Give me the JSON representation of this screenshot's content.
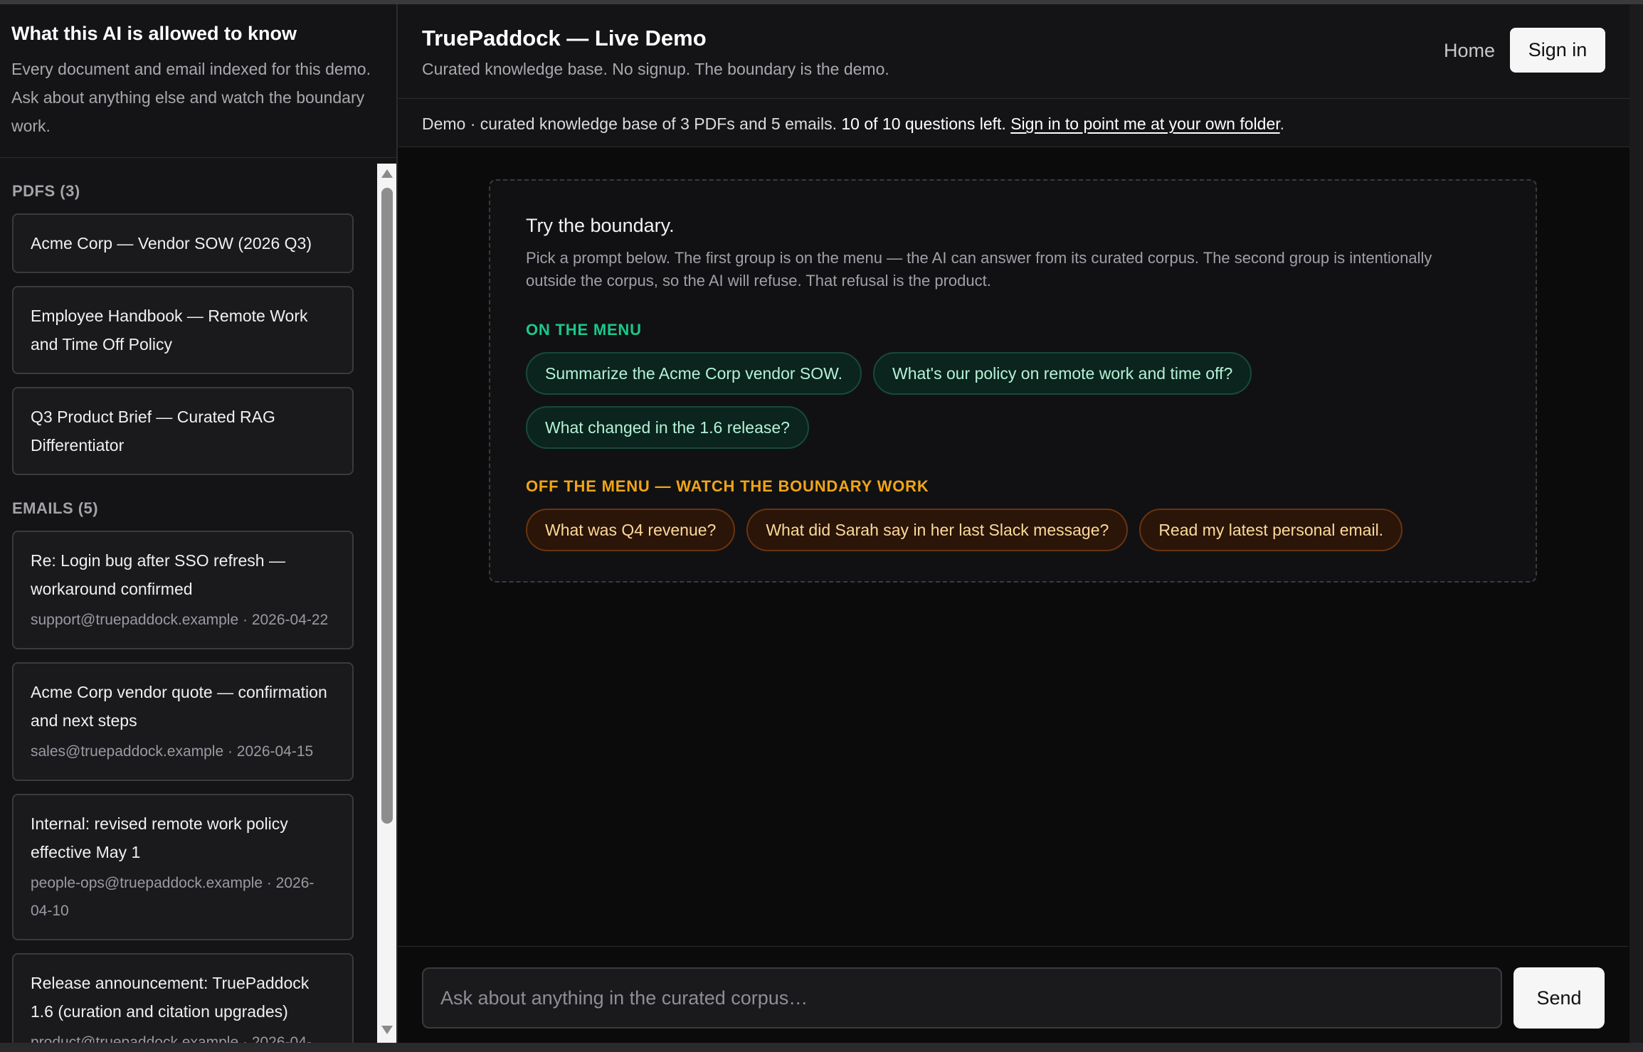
{
  "sidebar": {
    "title": "What this AI is allowed to know",
    "description": "Every document and email indexed for this demo. Ask about anything else and watch the boundary work.",
    "pdfs_label": "PDFS (3)",
    "pdfs": [
      {
        "title": "Acme Corp — Vendor SOW (2026 Q3)"
      },
      {
        "title": "Employee Handbook — Remote Work and Time Off Policy"
      },
      {
        "title": "Q3 Product Brief — Curated RAG Differentiator"
      }
    ],
    "emails_label": "EMAILS (5)",
    "emails": [
      {
        "title": "Re: Login bug after SSO refresh — workaround confirmed",
        "meta": "support@truepaddock.example · 2026-04-22"
      },
      {
        "title": "Acme Corp vendor quote — confirmation and next steps",
        "meta": "sales@truepaddock.example · 2026-04-15"
      },
      {
        "title": "Internal: revised remote work policy effective May 1",
        "meta": "people-ops@truepaddock.example · 2026-04-10"
      },
      {
        "title": "Release announcement: TruePaddock 1.6 (curation and citation upgrades)",
        "meta": "product@truepaddock.example · 2026-04-"
      }
    ]
  },
  "header": {
    "title": "TruePaddock — Live Demo",
    "subtitle": "Curated knowledge base. No signup. The boundary is the demo.",
    "home_label": "Home",
    "signin_label": "Sign in"
  },
  "notice": {
    "prefix": "Demo · curated knowledge base of 3 PDFs and 5 emails. ",
    "questions_left": "10 of 10 questions left.",
    "link": "Sign in to point me at your own folder",
    "suffix": "."
  },
  "panel": {
    "title": "Try the boundary.",
    "description": "Pick a prompt below. The first group is on the menu — the AI can answer from its curated corpus. The second group is intentionally outside the corpus, so the AI will refuse. That refusal is the product.",
    "on_menu_label": "ON THE MENU",
    "on_menu": [
      "Summarize the Acme Corp vendor SOW.",
      "What's our policy on remote work and time off?",
      "What changed in the 1.6 release?"
    ],
    "off_menu_label": "OFF THE MENU — WATCH THE BOUNDARY WORK",
    "off_menu": [
      "What was Q4 revenue?",
      "What did Sarah say in her last Slack message?",
      "Read my latest personal email."
    ]
  },
  "composer": {
    "placeholder": "Ask about anything in the curated corpus…",
    "send_label": "Send"
  },
  "colors": {
    "on_menu": "#18c98a",
    "off_menu": "#f0a515",
    "background": "#0b0b0c"
  }
}
